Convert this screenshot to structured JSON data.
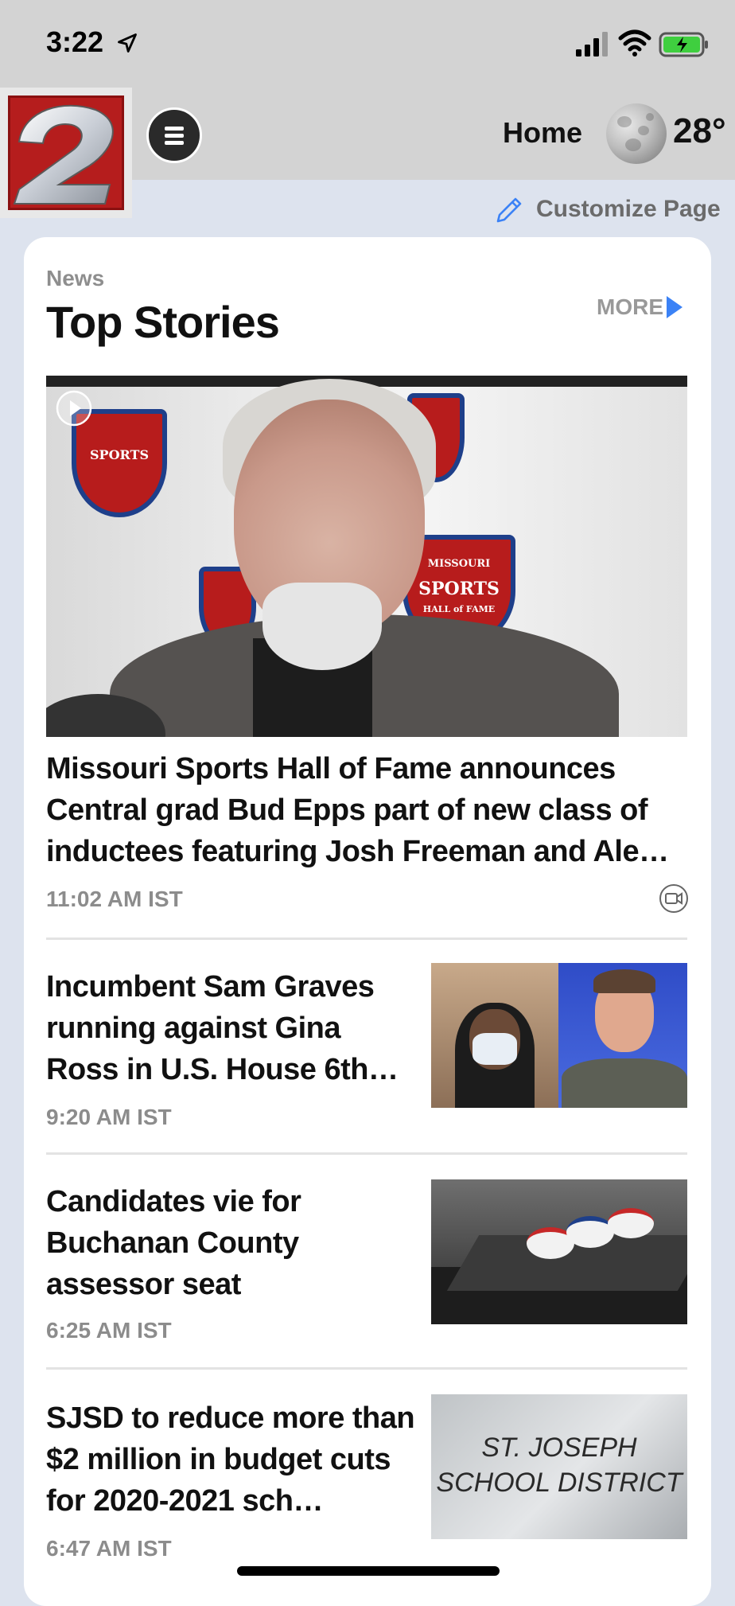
{
  "status_bar": {
    "time": "3:22",
    "icons": [
      "location-arrow-icon",
      "cellular-signal-icon",
      "wifi-icon",
      "battery-charging-icon"
    ]
  },
  "header": {
    "logo_text": "2",
    "nav_label": "Home",
    "weather": {
      "icon": "moon-icon",
      "temperature": "28°"
    }
  },
  "customize": {
    "label": "Customize Page",
    "icon": "pencil-icon"
  },
  "section": {
    "category": "News",
    "title": "Top Stories",
    "more_label": "MORE",
    "accent_color": "#3b82f6"
  },
  "hero": {
    "title": "Missouri Sports Hall of Fame announces Central grad Bud Epps part of new class of inductees featuring Josh Freeman and Ale…",
    "time": "11:02 AM IST",
    "badge_text_missouri": "MISSOURI",
    "badge_text_sports": "SPORTS",
    "badge_text_hall": "HALL of FAME"
  },
  "stories": [
    {
      "title": "Incumbent Sam Graves running against Gina Ross in U.S. House 6th…",
      "time": "9:20 AM IST"
    },
    {
      "title": "Candidates vie for Buchanan County assessor seat",
      "time": "6:25 AM IST"
    },
    {
      "title": "SJSD to reduce more than $2 million in budget cuts for 2020-2021 sch…",
      "time": "6:47 AM IST",
      "thumb_text_1": "ST. JOSEPH",
      "thumb_text_2": "SCHOOL DISTRICT"
    }
  ]
}
